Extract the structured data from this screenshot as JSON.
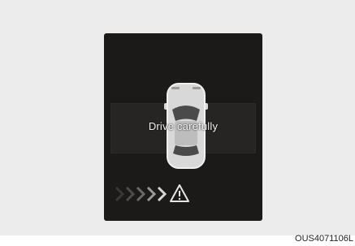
{
  "display": {
    "message": "Drive carefully",
    "car_icon": "car-top-view-icon",
    "warning_icon": "warning-triangle-icon",
    "direction_icon": "chevron-arrows-icon"
  },
  "figure_code": "OUS4071106L",
  "colors": {
    "screen": "#1c1a19",
    "text": "#f2f2f2",
    "background": "#ececec"
  }
}
